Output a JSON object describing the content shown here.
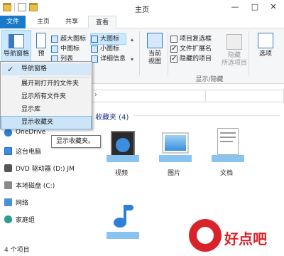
{
  "window": {
    "title": "主页",
    "minimize_glyph": "—",
    "maximize_glyph": "□",
    "close_glyph": "✕"
  },
  "ribbon_tabs": [
    "文件",
    "主页",
    "共享",
    "查看"
  ],
  "ribbon": {
    "pane_label": "导航窗格",
    "preview_pane_label": "预",
    "layout_col1": [
      "超大图标",
      "中图标",
      "列表"
    ],
    "layout_col2": [
      "大图标",
      "小图标",
      "详细信息"
    ],
    "current_view_label": "当前",
    "current_view_label2": "视图",
    "show_hide": {
      "item_checkboxes": "项目复选框",
      "file_extensions": "文件扩展名",
      "hidden_items": "隐藏的项目",
      "hide_label": "隐藏",
      "hide_label2": "所选项目",
      "group_label": "显示/隐藏"
    },
    "options_label": "选项"
  },
  "nav_menu": {
    "items": [
      "导航窗格",
      "展开到打开的文件夹",
      "显示所有文件夹",
      "显示库",
      "显示收藏夹"
    ],
    "checked_index": 0,
    "hover_index": 4
  },
  "tooltip": "显示收藏夹。",
  "nav_pane": {
    "items": [
      "OneDrive",
      "这台电脑",
      "DVD 驱动器 (D:) JM",
      "本地磁盘 (C:)",
      "网络",
      "家庭组"
    ]
  },
  "content": {
    "group_header": "收藏夹 (4)",
    "tiles": [
      "视频",
      "图片",
      "文档",
      ""
    ]
  },
  "status_bar": "4 个项目",
  "watermark": "好点吧",
  "colors": {
    "accent": "#1979ca",
    "selection": "#cce8ff",
    "watermark_red": "#d8232a",
    "group_header": "#1e3287"
  }
}
